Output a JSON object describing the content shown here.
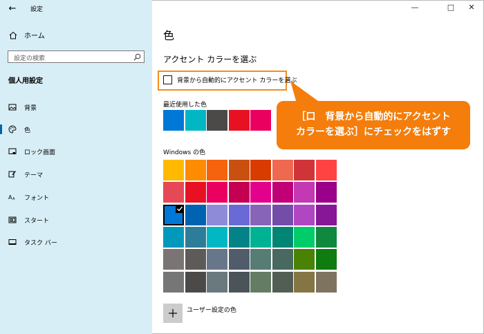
{
  "window": {
    "title": "設定",
    "controls": [
      "minimize-icon",
      "maximize-icon",
      "close-icon"
    ]
  },
  "sidebar": {
    "home_label": "ホーム",
    "search_placeholder": "設定の検索",
    "section_title": "個人用設定",
    "items": [
      {
        "label": "背景",
        "icon": "image-icon",
        "active": false
      },
      {
        "label": "色",
        "icon": "palette-icon",
        "active": true
      },
      {
        "label": "ロック画面",
        "icon": "lock-screen-icon",
        "active": false
      },
      {
        "label": "テーマ",
        "icon": "theme-brush-icon",
        "active": false
      },
      {
        "label": "フォント",
        "icon": "font-icon",
        "active": false
      },
      {
        "label": "スタート",
        "icon": "start-icon",
        "active": false
      },
      {
        "label": "タスク バー",
        "icon": "taskbar-icon",
        "active": false
      }
    ]
  },
  "main": {
    "page_title": "色",
    "subheading": "アクセント カラーを選ぶ",
    "auto_accent_label": "背景から自動的にアクセント カラーを選ぶ",
    "auto_accent_checked": false,
    "recent_colors_title": "最近使用した色",
    "recent_colors": [
      "#0078d7",
      "#00b7c3",
      "#4c4a48",
      "#e81123",
      "#ea005e"
    ],
    "windows_colors_title": "Windows の色",
    "windows_colors": [
      [
        "#ffb900",
        "#ff8c00",
        "#f7630c",
        "#ca5010",
        "#da3b01",
        "#ef6950",
        "#d13438",
        "#ff4343"
      ],
      [
        "#e74856",
        "#e81123",
        "#ea005e",
        "#c30052",
        "#e3008c",
        "#bf0077",
        "#c239b3",
        "#9a0089"
      ],
      [
        "#0078d7",
        "#0063b1",
        "#8e8cd8",
        "#6b69d6",
        "#8764b8",
        "#744da9",
        "#b146c2",
        "#881798"
      ],
      [
        "#0099bc",
        "#2d7d9a",
        "#00b7c3",
        "#038387",
        "#00b294",
        "#018574",
        "#00cc6a",
        "#10893e"
      ],
      [
        "#7a7574",
        "#5d5a58",
        "#68768a",
        "#515c6b",
        "#567c73",
        "#486860",
        "#498205",
        "#107c10"
      ],
      [
        "#767676",
        "#4c4a48",
        "#69797e",
        "#4a5459",
        "#647c64",
        "#525e54",
        "#847545",
        "#7e735f"
      ]
    ],
    "selected_color": "#0078d7",
    "custom_color_label": "ユーザー設定の色"
  },
  "callout": {
    "line1": "［口　背景から自動的にアクセント",
    "line2": "カラーを選ぶ］にチェックをはずす",
    "color": "#f47d0b"
  },
  "accent_color": "#0063b1"
}
